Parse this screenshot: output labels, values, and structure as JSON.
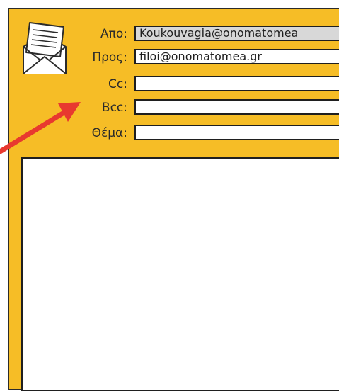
{
  "email": {
    "from": {
      "label": "Απο:",
      "value": "Koukouvagia@onomatomea"
    },
    "to": {
      "label": "Προς:",
      "value": "filoi@onomatomea.gr"
    },
    "cc": {
      "label": "Cc:",
      "value": ""
    },
    "bcc": {
      "label": "Bcc:",
      "value": ""
    },
    "subject": {
      "label": "Θέμα:",
      "value": ""
    },
    "body": ""
  },
  "colors": {
    "frame": "#f6bd26",
    "from_field": "#d8d8d8",
    "arrow": "#e8392f"
  },
  "icons": [
    "envelope-letter-icon",
    "red-arrow-annotation"
  ]
}
